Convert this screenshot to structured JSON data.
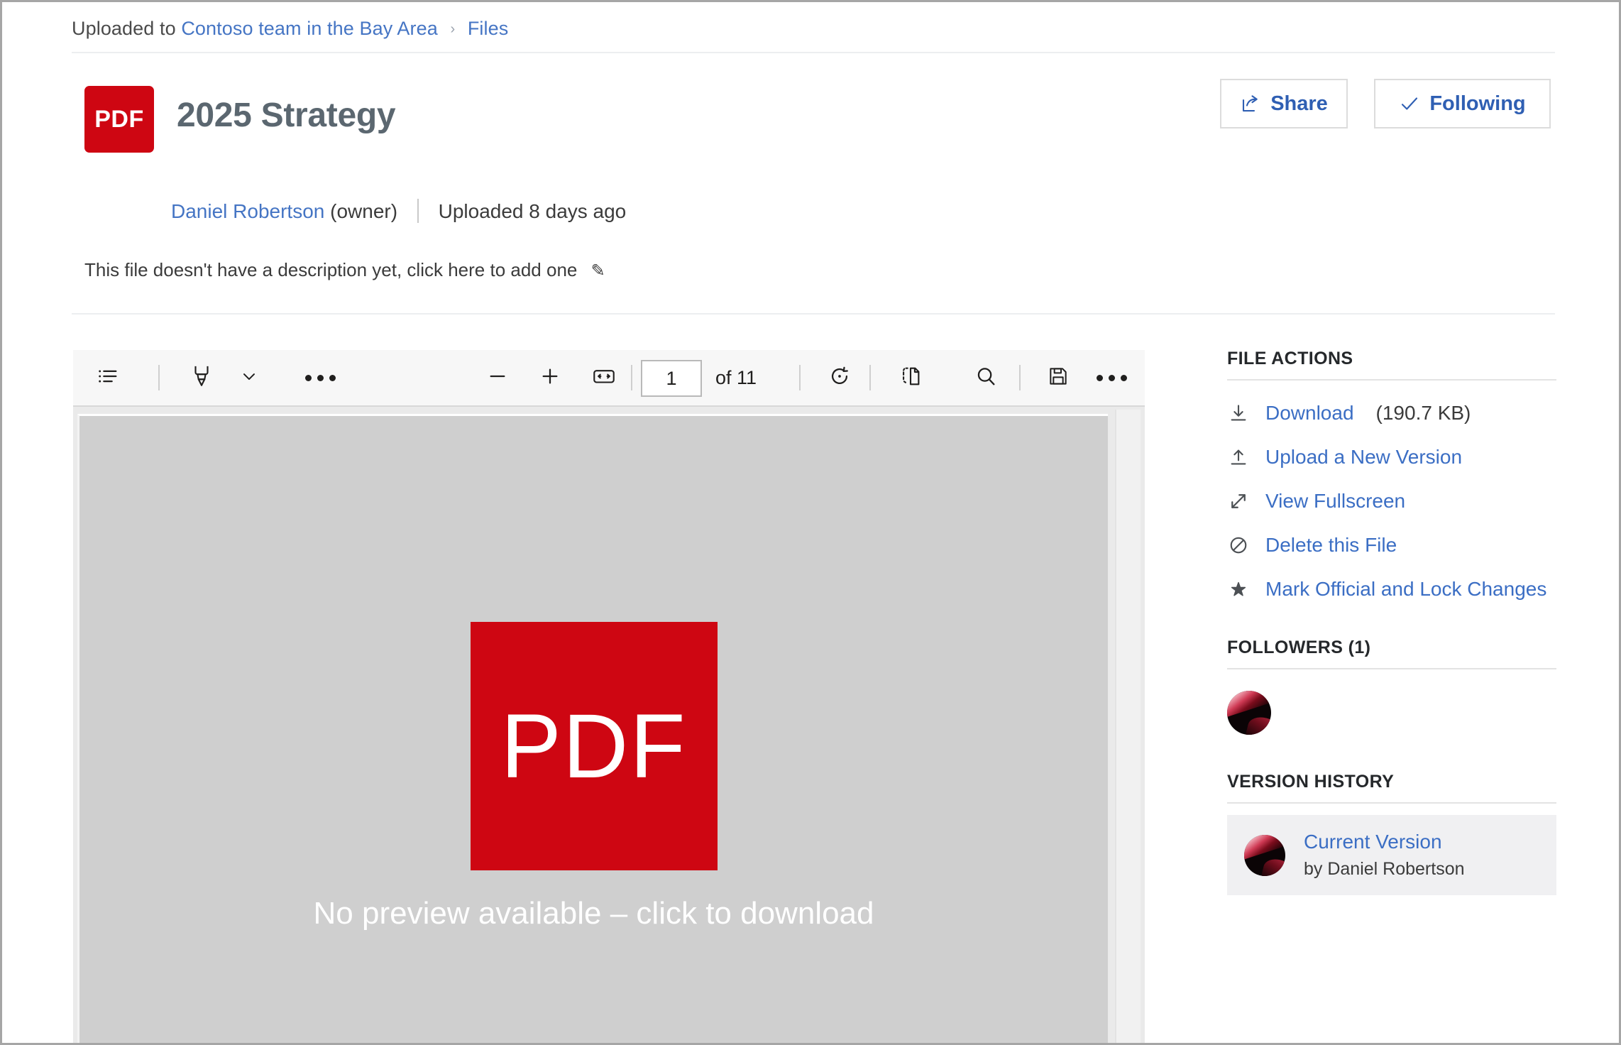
{
  "breadcrumb": {
    "prefix": "Uploaded to",
    "team": "Contoso team in the Bay Area",
    "separator": "›",
    "library": "Files"
  },
  "header": {
    "file_type_badge": "PDF",
    "title": "2025 Strategy",
    "share_label": "Share",
    "following_label": "Following",
    "share_icon": "share-arrow-icon",
    "following_icon": "checkmark-icon"
  },
  "meta": {
    "owner_name": "Daniel Robertson",
    "owner_role": "(owner)",
    "uploaded": "Uploaded 8 days ago",
    "description_prompt": "This file doesn't have a description yet, click here to add one",
    "description_edit_icon": "pencil-icon"
  },
  "viewer": {
    "toolbar": {
      "outline_icon": "list-outline-icon",
      "highlighter_icon": "highlighter-pen-icon",
      "highlighter_dropdown_icon": "chevron-down-icon",
      "annotate_more_icon": "ellipsis-icon",
      "zoom_out_icon": "minus-icon",
      "zoom_in_icon": "plus-icon",
      "fit_width_icon": "fit-to-width-icon",
      "page_number": "1",
      "page_total": "of 11",
      "rotate_icon": "rotate-icon",
      "page_layout_icon": "page-thumbnail-icon",
      "search_icon": "search-icon",
      "save_icon": "save-floppy-icon",
      "more_icon": "ellipsis-icon"
    },
    "preview": {
      "badge_text": "PDF",
      "message": "No preview available – click to download"
    }
  },
  "panel": {
    "file_actions_title": "FILE ACTIONS",
    "actions": [
      {
        "label": "Download",
        "size": "(190.7 KB)",
        "icon": "download-icon"
      },
      {
        "label": "Upload a New Version",
        "size": "",
        "icon": "upload-icon"
      },
      {
        "label": "View Fullscreen",
        "size": "",
        "icon": "fullscreen-icon"
      },
      {
        "label": "Delete this File",
        "size": "",
        "icon": "block-delete-icon"
      },
      {
        "label": "Mark Official and Lock Changes",
        "size": "",
        "icon": "star-icon"
      }
    ],
    "followers_title": "FOLLOWERS (1)",
    "version_history_title": "VERSION HISTORY",
    "version": {
      "title": "Current Version",
      "by": "by Daniel Robertson"
    }
  },
  "colors": {
    "pdf_red": "#ce0612",
    "link_blue": "#3b6ec4",
    "title_slate": "#5b6770",
    "preview_gray": "#cfcfcf"
  }
}
